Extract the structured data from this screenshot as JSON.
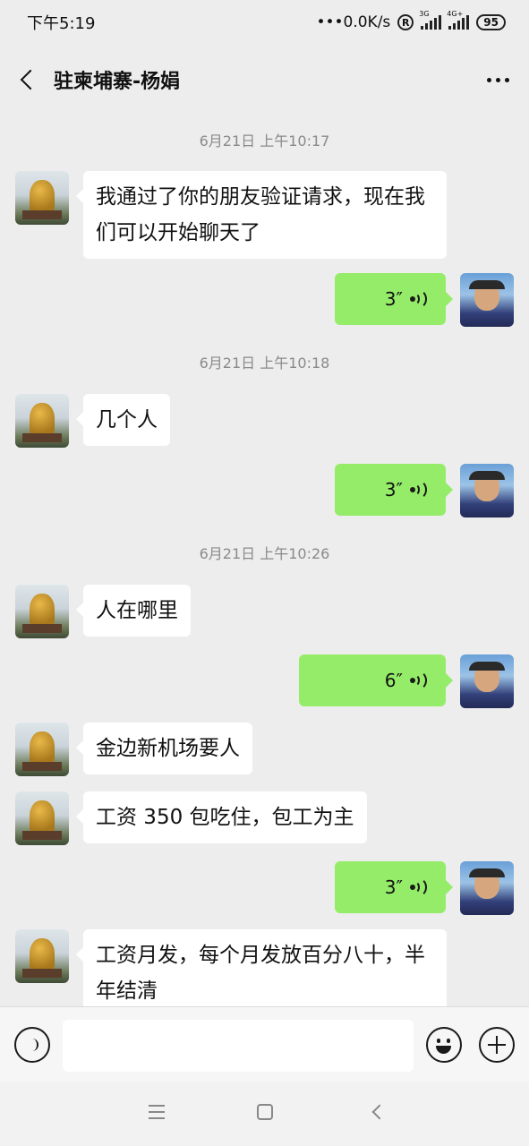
{
  "status_bar": {
    "time": "下午5:19",
    "net_speed": "•••0.0K/s",
    "registered_mark": "R",
    "signal1_tag": "3G",
    "signal2_tag": "4G+",
    "battery": "95"
  },
  "header": {
    "title": "驻柬埔寨-杨娟"
  },
  "messages": {
    "ts1": "6月21日 上午10:17",
    "m1": "我通过了你的朋友验证请求，现在我们可以开始聊天了",
    "v1": "3″",
    "ts2": "6月21日 上午10:18",
    "m2": "几个人",
    "v2": "3″",
    "ts3": "6月21日 上午10:26",
    "m3": "人在哪里",
    "v3": "6″",
    "m4": "金边新机场要人",
    "m5": "工资 350 包吃住，包工为主",
    "v4": "3″",
    "m6": "工资月发，每个月发放百分八十，半年结清"
  },
  "input": {
    "value": "",
    "placeholder": ""
  },
  "colors": {
    "background": "#ededed",
    "sent_bubble": "#95ec69",
    "received_bubble": "#ffffff",
    "timestamp": "#8a8a8a"
  }
}
